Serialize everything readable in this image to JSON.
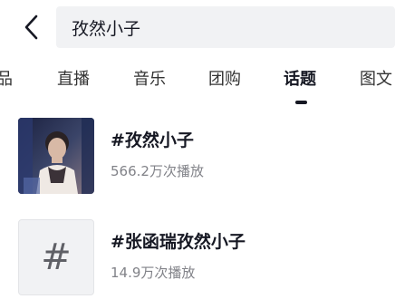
{
  "search": {
    "back_icon": "chevron-left-icon",
    "query": "孜然小子"
  },
  "tabs": [
    {
      "label": "品"
    },
    {
      "label": "直播"
    },
    {
      "label": "音乐"
    },
    {
      "label": "团购"
    },
    {
      "label": "话题",
      "active": true
    },
    {
      "label": "图文"
    }
  ],
  "results": [
    {
      "title": "#孜然小子",
      "meta": "566.2万次播放",
      "thumbnail": "photo"
    },
    {
      "title": "#张函瑞孜然小子",
      "meta": "14.9万次播放",
      "thumbnail": "hashtag-placeholder",
      "thumbnail_glyph": "#"
    }
  ],
  "colors": {
    "text_primary": "#161823",
    "text_secondary": "#818288",
    "search_bg": "#f1f2f4"
  }
}
